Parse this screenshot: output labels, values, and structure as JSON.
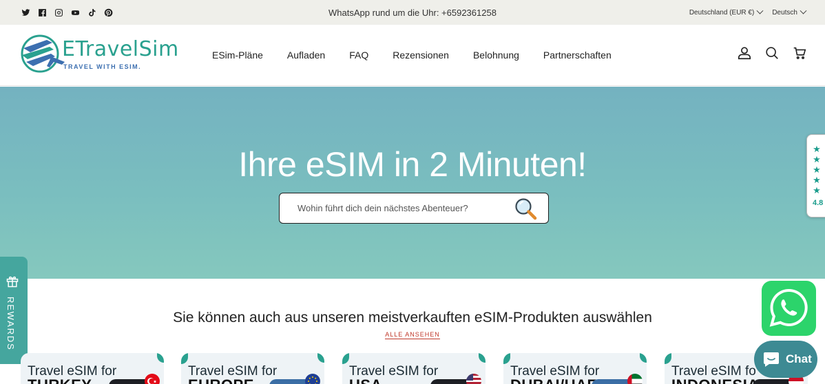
{
  "topbar": {
    "social_icons": [
      "twitter-icon",
      "facebook-icon",
      "instagram-icon",
      "youtube-icon",
      "tiktok-icon",
      "pinterest-icon"
    ],
    "announcement": "WhatsApp rund um die Uhr: +6592361258",
    "country_selector": "Deutschland (EUR €)",
    "language_selector": "Deutsch"
  },
  "header": {
    "logo_text": "ETravelSim",
    "logo_tagline": "TRAVEL WITH ESIM.",
    "nav": [
      "ESim-Pläne",
      "Aufladen",
      "FAQ",
      "Rezensionen",
      "Belohnung",
      "Partnerschaften"
    ],
    "icons": [
      "account-icon",
      "search-icon",
      "cart-icon"
    ]
  },
  "hero": {
    "title": "Ihre eSIM in 2 Minuten!",
    "search_placeholder": "Wohin führt dich dein nächstes Abenteuer?"
  },
  "reviews_badge": {
    "stars": 5,
    "score": "4.8"
  },
  "rewards_tab": {
    "label": "REWARDS"
  },
  "products": {
    "title": "Sie können auch aus unseren meistverkauften eSIM-Produkten auswählen",
    "view_all": "ALLE ANSEHEN",
    "cards": [
      {
        "line1": "Travel eSIM for",
        "line2": "TURKEY",
        "flag": "turkey-flag"
      },
      {
        "line1": "Travel eSIM for",
        "line2": "EUROPE",
        "flag": "eu-flag"
      },
      {
        "line1": "Travel eSIM for",
        "line2": "USA",
        "flag": "usa-flag"
      },
      {
        "line1": "Travel eSIM for",
        "line2": "DUBAI/UAE",
        "flag": "uae-flag"
      },
      {
        "line1": "Travel eSIM fo",
        "line2": "INDONESIA",
        "flag": "indonesia-flag"
      }
    ]
  },
  "chat_widget": {
    "label": "Chat"
  },
  "colors": {
    "hero_top": "#74b2c0",
    "hero_bottom": "#85c8be",
    "accent": "#2aa18f",
    "link_red": "#c0392b",
    "whatsapp": "#2cd46b",
    "chat": "#3d8a93"
  }
}
